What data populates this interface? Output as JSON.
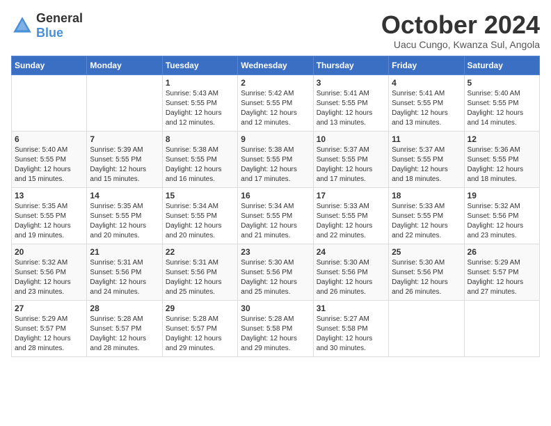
{
  "logo": {
    "general": "General",
    "blue": "Blue"
  },
  "title": {
    "month": "October 2024",
    "location": "Uacu Cungo, Kwanza Sul, Angola"
  },
  "weekdays": [
    "Sunday",
    "Monday",
    "Tuesday",
    "Wednesday",
    "Thursday",
    "Friday",
    "Saturday"
  ],
  "weeks": [
    [
      {
        "day": "",
        "sunrise": "",
        "sunset": "",
        "daylight": ""
      },
      {
        "day": "",
        "sunrise": "",
        "sunset": "",
        "daylight": ""
      },
      {
        "day": "1",
        "sunrise": "Sunrise: 5:43 AM",
        "sunset": "Sunset: 5:55 PM",
        "daylight": "Daylight: 12 hours and 12 minutes."
      },
      {
        "day": "2",
        "sunrise": "Sunrise: 5:42 AM",
        "sunset": "Sunset: 5:55 PM",
        "daylight": "Daylight: 12 hours and 12 minutes."
      },
      {
        "day": "3",
        "sunrise": "Sunrise: 5:41 AM",
        "sunset": "Sunset: 5:55 PM",
        "daylight": "Daylight: 12 hours and 13 minutes."
      },
      {
        "day": "4",
        "sunrise": "Sunrise: 5:41 AM",
        "sunset": "Sunset: 5:55 PM",
        "daylight": "Daylight: 12 hours and 13 minutes."
      },
      {
        "day": "5",
        "sunrise": "Sunrise: 5:40 AM",
        "sunset": "Sunset: 5:55 PM",
        "daylight": "Daylight: 12 hours and 14 minutes."
      }
    ],
    [
      {
        "day": "6",
        "sunrise": "Sunrise: 5:40 AM",
        "sunset": "Sunset: 5:55 PM",
        "daylight": "Daylight: 12 hours and 15 minutes."
      },
      {
        "day": "7",
        "sunrise": "Sunrise: 5:39 AM",
        "sunset": "Sunset: 5:55 PM",
        "daylight": "Daylight: 12 hours and 15 minutes."
      },
      {
        "day": "8",
        "sunrise": "Sunrise: 5:38 AM",
        "sunset": "Sunset: 5:55 PM",
        "daylight": "Daylight: 12 hours and 16 minutes."
      },
      {
        "day": "9",
        "sunrise": "Sunrise: 5:38 AM",
        "sunset": "Sunset: 5:55 PM",
        "daylight": "Daylight: 12 hours and 17 minutes."
      },
      {
        "day": "10",
        "sunrise": "Sunrise: 5:37 AM",
        "sunset": "Sunset: 5:55 PM",
        "daylight": "Daylight: 12 hours and 17 minutes."
      },
      {
        "day": "11",
        "sunrise": "Sunrise: 5:37 AM",
        "sunset": "Sunset: 5:55 PM",
        "daylight": "Daylight: 12 hours and 18 minutes."
      },
      {
        "day": "12",
        "sunrise": "Sunrise: 5:36 AM",
        "sunset": "Sunset: 5:55 PM",
        "daylight": "Daylight: 12 hours and 18 minutes."
      }
    ],
    [
      {
        "day": "13",
        "sunrise": "Sunrise: 5:35 AM",
        "sunset": "Sunset: 5:55 PM",
        "daylight": "Daylight: 12 hours and 19 minutes."
      },
      {
        "day": "14",
        "sunrise": "Sunrise: 5:35 AM",
        "sunset": "Sunset: 5:55 PM",
        "daylight": "Daylight: 12 hours and 20 minutes."
      },
      {
        "day": "15",
        "sunrise": "Sunrise: 5:34 AM",
        "sunset": "Sunset: 5:55 PM",
        "daylight": "Daylight: 12 hours and 20 minutes."
      },
      {
        "day": "16",
        "sunrise": "Sunrise: 5:34 AM",
        "sunset": "Sunset: 5:55 PM",
        "daylight": "Daylight: 12 hours and 21 minutes."
      },
      {
        "day": "17",
        "sunrise": "Sunrise: 5:33 AM",
        "sunset": "Sunset: 5:55 PM",
        "daylight": "Daylight: 12 hours and 22 minutes."
      },
      {
        "day": "18",
        "sunrise": "Sunrise: 5:33 AM",
        "sunset": "Sunset: 5:55 PM",
        "daylight": "Daylight: 12 hours and 22 minutes."
      },
      {
        "day": "19",
        "sunrise": "Sunrise: 5:32 AM",
        "sunset": "Sunset: 5:56 PM",
        "daylight": "Daylight: 12 hours and 23 minutes."
      }
    ],
    [
      {
        "day": "20",
        "sunrise": "Sunrise: 5:32 AM",
        "sunset": "Sunset: 5:56 PM",
        "daylight": "Daylight: 12 hours and 23 minutes."
      },
      {
        "day": "21",
        "sunrise": "Sunrise: 5:31 AM",
        "sunset": "Sunset: 5:56 PM",
        "daylight": "Daylight: 12 hours and 24 minutes."
      },
      {
        "day": "22",
        "sunrise": "Sunrise: 5:31 AM",
        "sunset": "Sunset: 5:56 PM",
        "daylight": "Daylight: 12 hours and 25 minutes."
      },
      {
        "day": "23",
        "sunrise": "Sunrise: 5:30 AM",
        "sunset": "Sunset: 5:56 PM",
        "daylight": "Daylight: 12 hours and 25 minutes."
      },
      {
        "day": "24",
        "sunrise": "Sunrise: 5:30 AM",
        "sunset": "Sunset: 5:56 PM",
        "daylight": "Daylight: 12 hours and 26 minutes."
      },
      {
        "day": "25",
        "sunrise": "Sunrise: 5:30 AM",
        "sunset": "Sunset: 5:56 PM",
        "daylight": "Daylight: 12 hours and 26 minutes."
      },
      {
        "day": "26",
        "sunrise": "Sunrise: 5:29 AM",
        "sunset": "Sunset: 5:57 PM",
        "daylight": "Daylight: 12 hours and 27 minutes."
      }
    ],
    [
      {
        "day": "27",
        "sunrise": "Sunrise: 5:29 AM",
        "sunset": "Sunset: 5:57 PM",
        "daylight": "Daylight: 12 hours and 28 minutes."
      },
      {
        "day": "28",
        "sunrise": "Sunrise: 5:28 AM",
        "sunset": "Sunset: 5:57 PM",
        "daylight": "Daylight: 12 hours and 28 minutes."
      },
      {
        "day": "29",
        "sunrise": "Sunrise: 5:28 AM",
        "sunset": "Sunset: 5:57 PM",
        "daylight": "Daylight: 12 hours and 29 minutes."
      },
      {
        "day": "30",
        "sunrise": "Sunrise: 5:28 AM",
        "sunset": "Sunset: 5:58 PM",
        "daylight": "Daylight: 12 hours and 29 minutes."
      },
      {
        "day": "31",
        "sunrise": "Sunrise: 5:27 AM",
        "sunset": "Sunset: 5:58 PM",
        "daylight": "Daylight: 12 hours and 30 minutes."
      },
      {
        "day": "",
        "sunrise": "",
        "sunset": "",
        "daylight": ""
      },
      {
        "day": "",
        "sunrise": "",
        "sunset": "",
        "daylight": ""
      }
    ]
  ]
}
